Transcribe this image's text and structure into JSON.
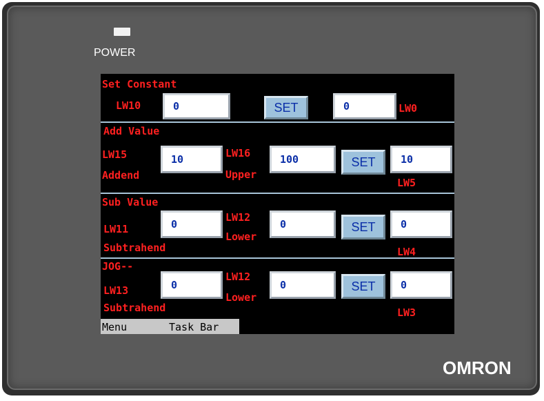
{
  "device": {
    "power_label": "POWER",
    "brand": "OMRON"
  },
  "sections": {
    "set_constant": {
      "title": "Set Constant",
      "input_label": "LW10",
      "input_value": "0",
      "button": "SET",
      "output_value": "0",
      "output_label": "LW0"
    },
    "add_value": {
      "title": "Add Value",
      "addend_label": "LW15",
      "addend_sub": "Addend",
      "addend_value": "10",
      "upper_label": "LW16",
      "upper_sub": "Upper",
      "upper_value": "100",
      "button": "SET",
      "output_value": "10",
      "output_label": "LW5"
    },
    "sub_value": {
      "title": "Sub Value",
      "sub_label": "LW11",
      "sub_sub": "Subtrahend",
      "sub_value": "0",
      "lower_label": "LW12",
      "lower_sub": "Lower",
      "lower_value": "0",
      "button": "SET",
      "output_value": "0",
      "output_label": "LW4"
    },
    "jog": {
      "title": "JOG--",
      "sub_label": "LW13",
      "sub_sub": "Subtrahend",
      "sub_value": "0",
      "lower_label": "LW12",
      "lower_sub": "Lower",
      "lower_value": "0",
      "button": "SET",
      "output_value": "0",
      "output_label": "LW3"
    }
  },
  "taskbar": {
    "menu": "Menu",
    "task_bar": "Task Bar"
  },
  "colors": {
    "screen_bg": "#000000",
    "label_red": "#ff2020",
    "value_blue": "#0b2fa8",
    "button_blue": "#9ec2dc",
    "separator": "#a8c4d8"
  }
}
